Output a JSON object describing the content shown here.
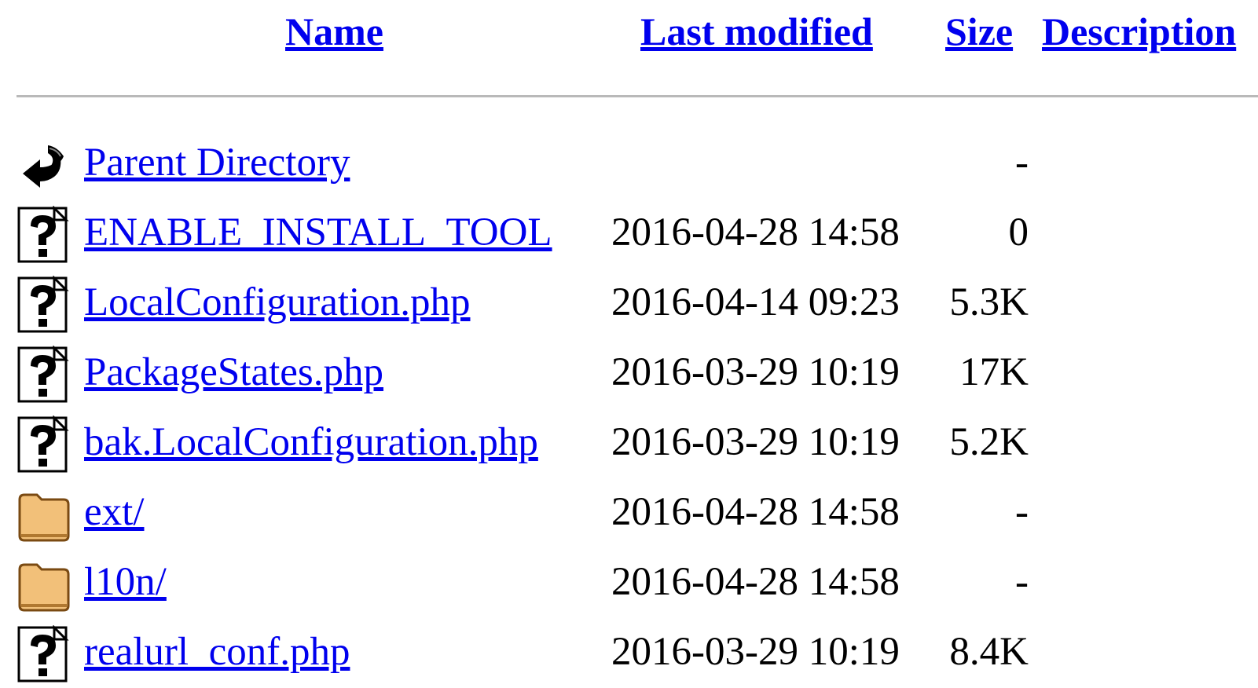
{
  "columns": {
    "name": "Name",
    "last_modified": "Last modified",
    "size": "Size",
    "description": "Description"
  },
  "entries": [
    {
      "name": "Parent Directory",
      "date": "",
      "size": "-",
      "icon": "back-icon"
    },
    {
      "name": "ENABLE_INSTALL_TOOL",
      "date": "2016-04-28 14:58",
      "size": "0",
      "icon": "unknown-file-icon"
    },
    {
      "name": "LocalConfiguration.php",
      "date": "2016-04-14 09:23",
      "size": "5.3K",
      "icon": "unknown-file-icon"
    },
    {
      "name": "PackageStates.php",
      "date": "2016-03-29 10:19",
      "size": "17K",
      "icon": "unknown-file-icon"
    },
    {
      "name": "bak.LocalConfiguration.php",
      "date": "2016-03-29 10:19",
      "size": "5.2K",
      "icon": "unknown-file-icon"
    },
    {
      "name": "ext/",
      "date": "2016-04-28 14:58",
      "size": "-",
      "icon": "folder-icon"
    },
    {
      "name": "l10n/",
      "date": "2016-04-28 14:58",
      "size": "-",
      "icon": "folder-icon"
    },
    {
      "name": "realurl_conf.php",
      "date": "2016-03-29 10:19",
      "size": "8.4K",
      "icon": "unknown-file-icon"
    }
  ],
  "colors": {
    "link": "#0000ee",
    "rule": "#b9b9b9",
    "folder_fill": "#f2c079"
  }
}
